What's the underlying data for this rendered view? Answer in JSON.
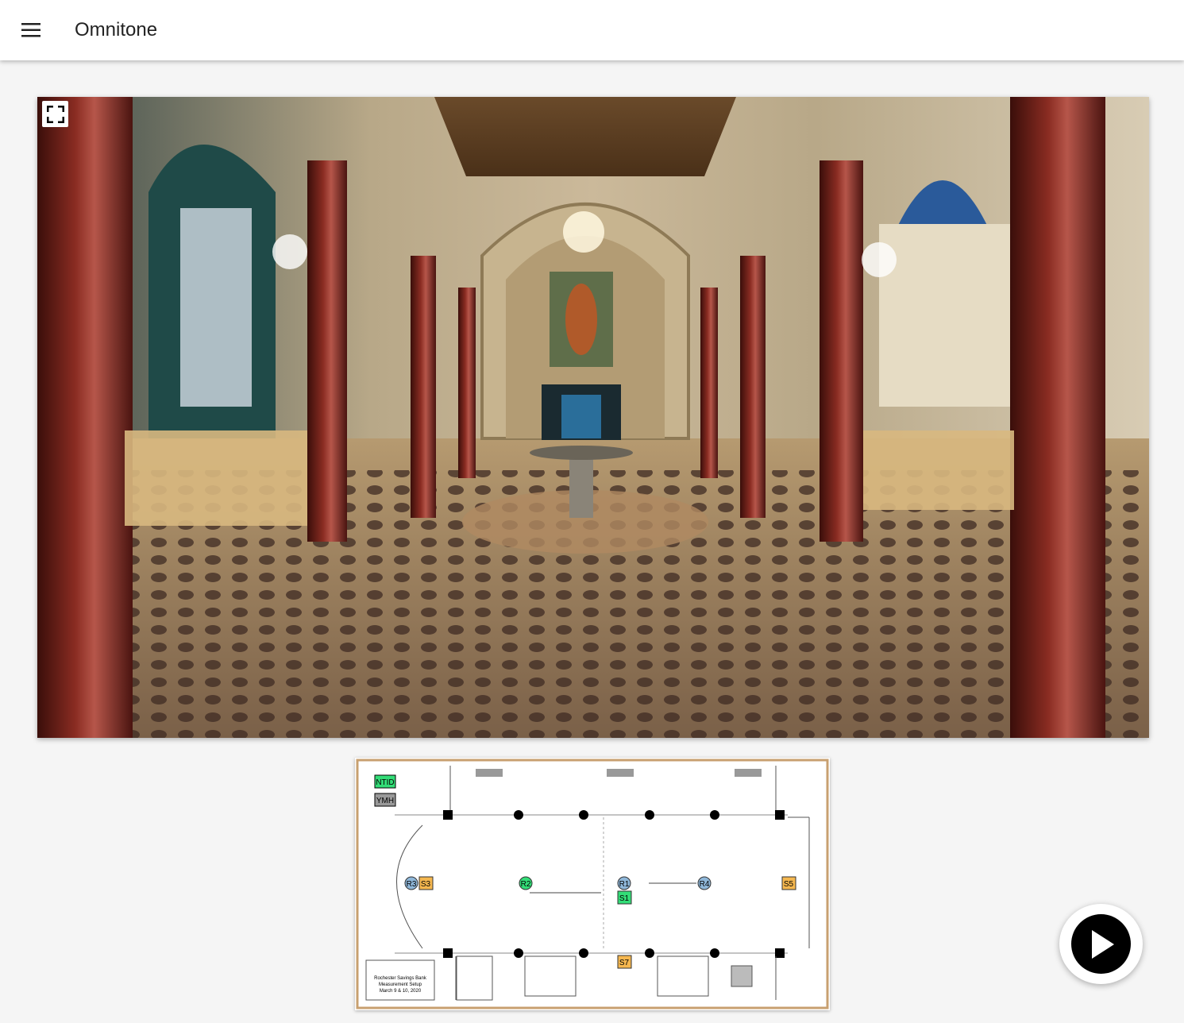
{
  "header": {
    "title": "Omnitone",
    "menu_icon": "menu-icon"
  },
  "viewer": {
    "fullscreen_icon": "fullscreen-icon"
  },
  "floorplan": {
    "legend": [
      "NTID",
      "YMH"
    ],
    "markers": [
      {
        "id": "R3",
        "type": "receiver"
      },
      {
        "id": "S3",
        "type": "source-ymh"
      },
      {
        "id": "R2",
        "type": "receiver-ntid"
      },
      {
        "id": "R1",
        "type": "receiver"
      },
      {
        "id": "S1",
        "type": "source-ntid"
      },
      {
        "id": "R4",
        "type": "receiver"
      },
      {
        "id": "S5",
        "type": "source-ymh"
      },
      {
        "id": "S7",
        "type": "source-ymh"
      }
    ],
    "title_block": [
      "Rochester Savings Bank",
      "Measurement Setup",
      "March 9 & 10, 2020"
    ]
  },
  "colors": {
    "ntid": "#33dd77",
    "ymh": "#f5b74f",
    "receiver": "#8fb7d9"
  },
  "player": {
    "play_icon": "play-icon"
  }
}
